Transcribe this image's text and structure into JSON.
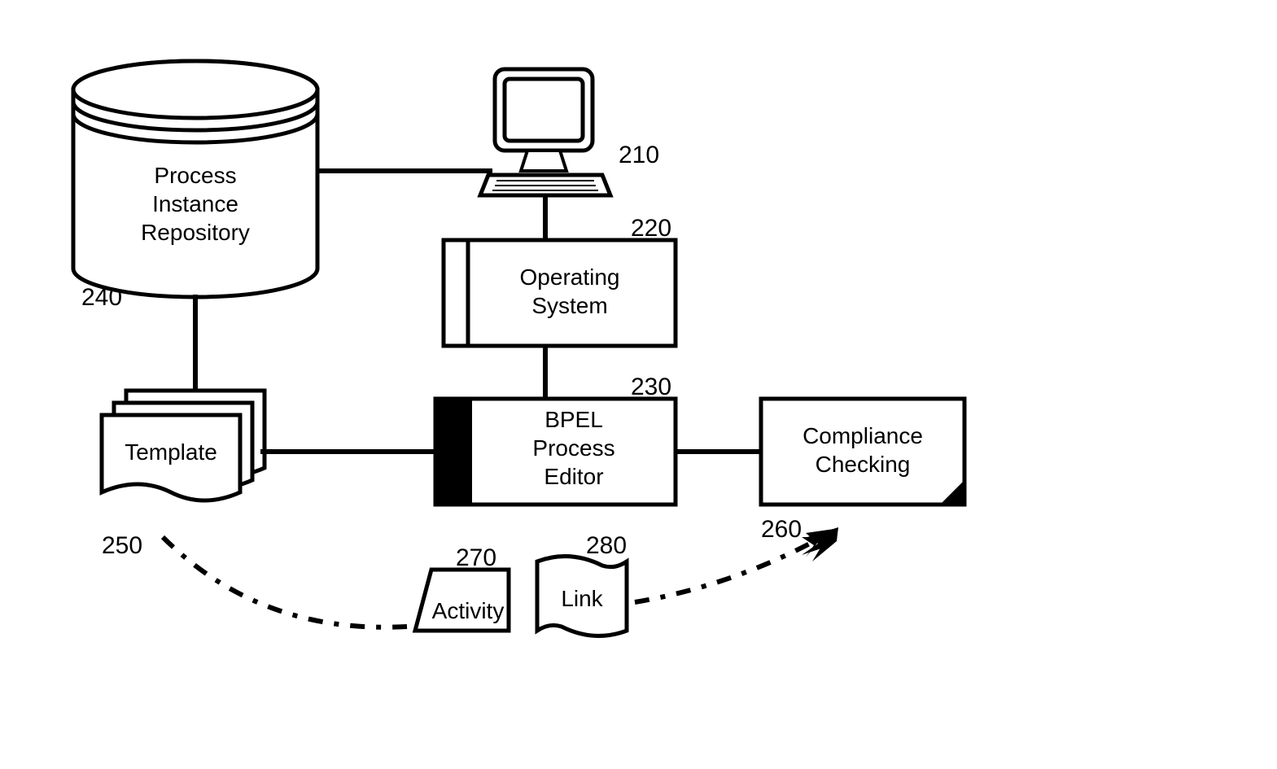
{
  "nodes": {
    "repository": {
      "line1": "Process",
      "line2": "Instance",
      "line3": "Repository",
      "ref": "240"
    },
    "computer": {
      "ref": "210"
    },
    "os": {
      "line1": "Operating",
      "line2": "System",
      "ref": "220"
    },
    "editor": {
      "line1": "BPEL",
      "line2": "Process",
      "line3": "Editor",
      "ref": "230"
    },
    "template": {
      "label": "Template",
      "ref": "250"
    },
    "compliance": {
      "line1": "Compliance",
      "line2": "Checking",
      "ref": "260"
    },
    "activity": {
      "label": "Activity",
      "ref": "270"
    },
    "link": {
      "label": "Link",
      "ref": "280"
    }
  }
}
